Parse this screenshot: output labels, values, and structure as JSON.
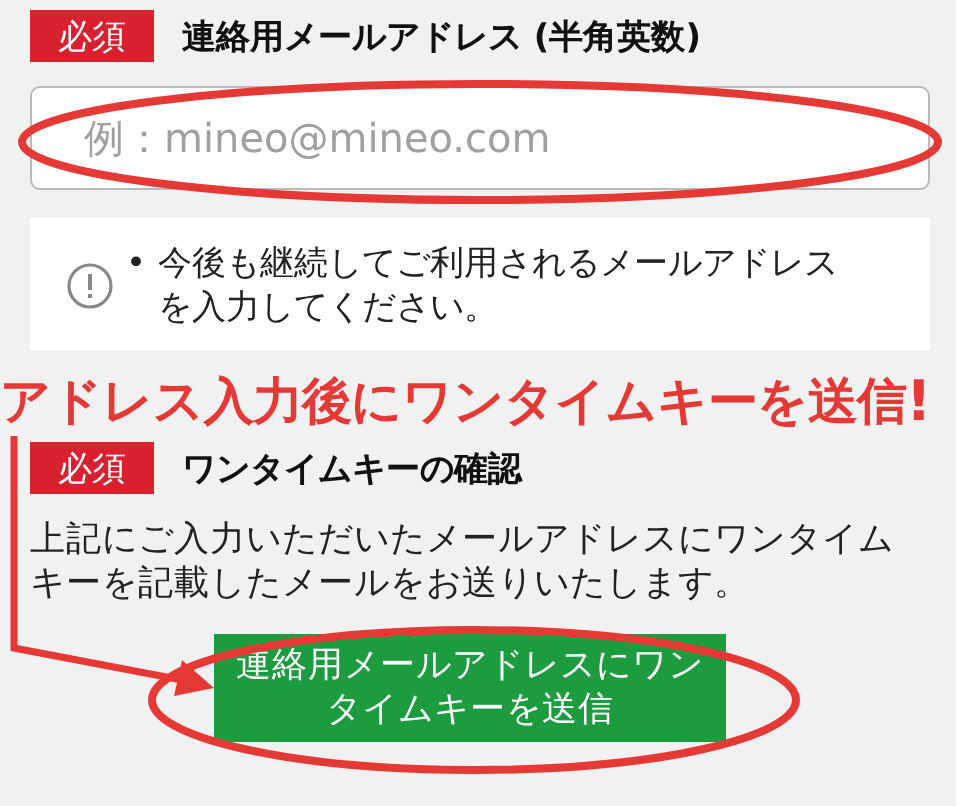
{
  "email_section": {
    "required_badge": "必須",
    "label": "連絡用メールアドレス (半角英数)",
    "field": {
      "placeholder": "例：mineo@mineo.com",
      "highlighted": true
    }
  },
  "notice": {
    "bullet": "•",
    "text": "今後も継続してご利用されるメールアドレスを入力してください。"
  },
  "annotation": {
    "text": "アドレス入力後にワンタイムキーを送信",
    "mark": "!"
  },
  "onetime_section": {
    "required_badge": "必須",
    "label": "ワンタイムキーの確認",
    "description": "上記にご入力いただいたメールアドレスにワンタイムキーを記載したメールをお送りいたします。",
    "button": {
      "label": "連絡用メールアドレスにワンタイムキーを送信",
      "highlighted": true
    }
  }
}
